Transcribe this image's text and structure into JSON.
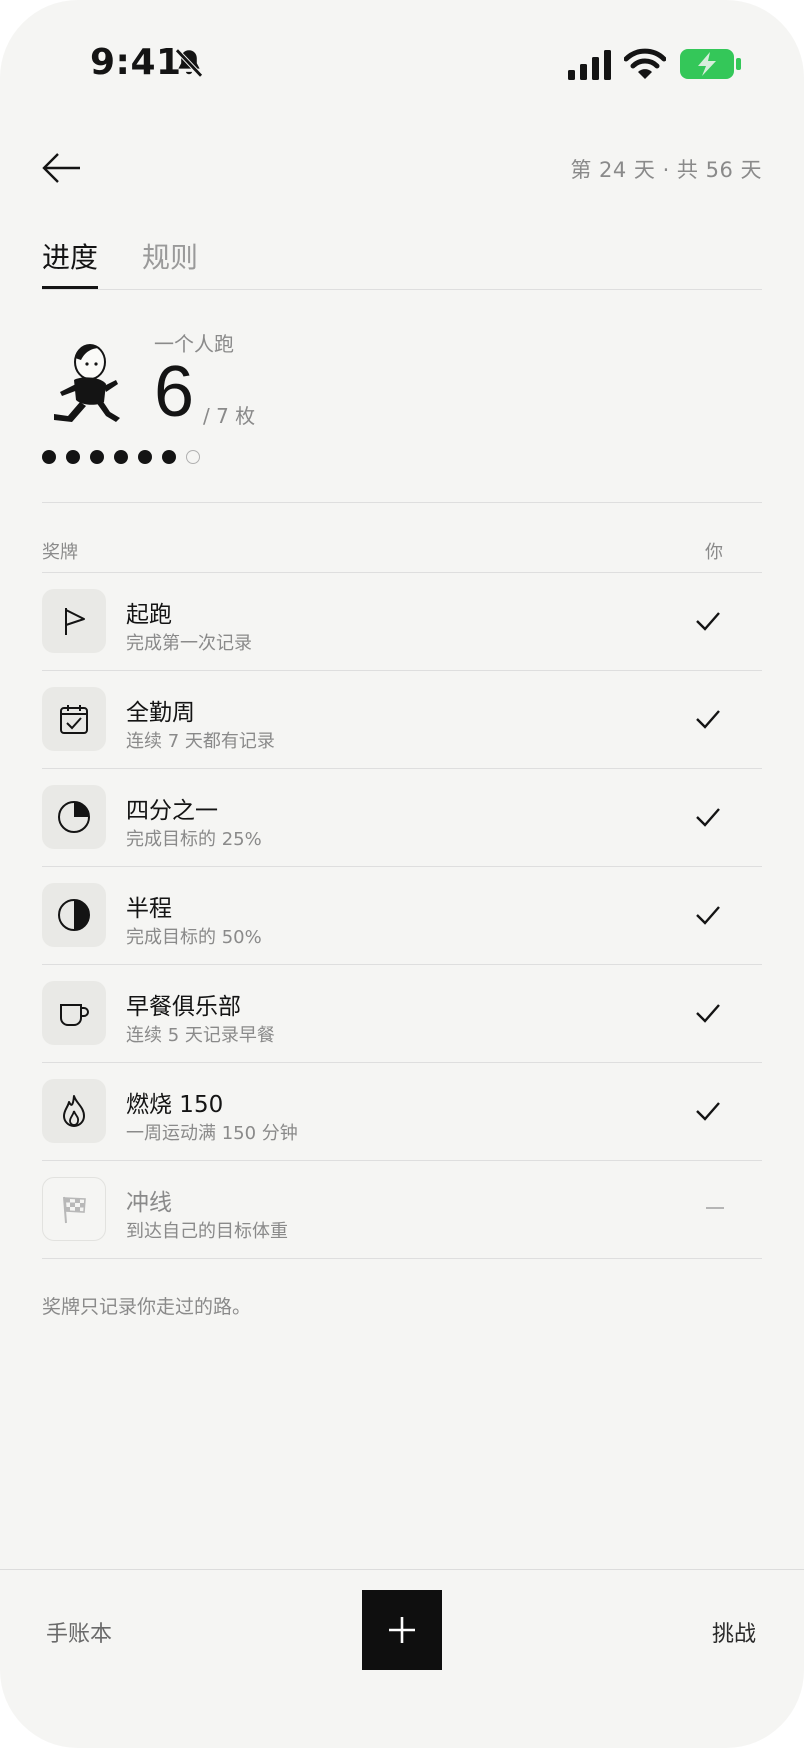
{
  "status_bar": {
    "time": "9:41"
  },
  "header": {
    "day_counter": "第 24 天 · 共 56 天"
  },
  "tabs": [
    {
      "label": "进度"
    },
    {
      "label": "规则"
    }
  ],
  "summary": {
    "challenge_name": "一个人跑",
    "earned": "6",
    "total_label": "/ 7 枚",
    "earned_fraction": 0.857
  },
  "list_header": {
    "badges": "奖牌",
    "you": "你"
  },
  "badges": [
    {
      "title": "起跑",
      "desc": "完成第一次记录",
      "icon": "flag-icon",
      "earned": true
    },
    {
      "title": "全勤周",
      "desc": "连续 7 天都有记录",
      "icon": "calendar-check-icon",
      "earned": true
    },
    {
      "title": "四分之一",
      "desc": "完成目标的 25%",
      "icon": "quarter-pie-icon",
      "earned": true
    },
    {
      "title": "半程",
      "desc": "完成目标的 50%",
      "icon": "half-circle-icon",
      "earned": true
    },
    {
      "title": "早餐俱乐部",
      "desc": "连续 5 天记录早餐",
      "icon": "coffee-cup-icon",
      "earned": true
    },
    {
      "title": "燃烧 150",
      "desc": "一周运动满 150 分钟",
      "icon": "flame-icon",
      "earned": true
    },
    {
      "title": "冲线",
      "desc": "到达自己的目标体重",
      "icon": "checkered-flag-icon",
      "earned": false
    }
  ],
  "footnote": "奖牌只记录你走过的路。",
  "bottom_nav": {
    "journal": "手账本",
    "challenge": "挑战"
  },
  "colors": {
    "background": "#f5f5f3",
    "ink": "#141414",
    "muted": "#8a8a8a",
    "battery": "#34c759"
  }
}
